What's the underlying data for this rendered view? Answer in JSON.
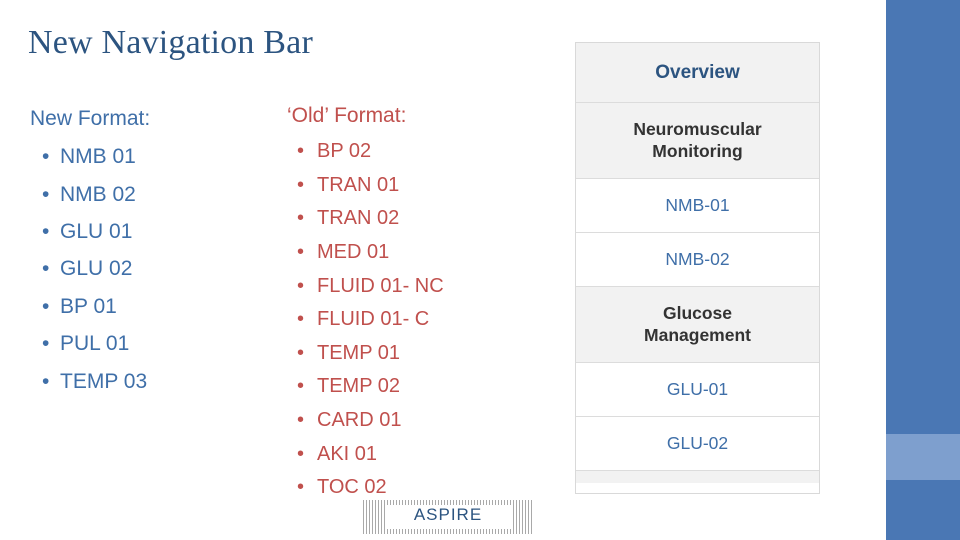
{
  "slide": {
    "title": "New Navigation Bar"
  },
  "columns": {
    "new": {
      "heading": "New Format:",
      "bullet_glyph": "•",
      "items": [
        "NMB 01",
        "NMB 02",
        "GLU 01",
        "GLU 02",
        "BP 01",
        "PUL 01",
        "TEMP 03"
      ]
    },
    "old": {
      "heading": "‘Old’ Format:",
      "bullet_glyph": "•",
      "items": [
        "BP 02",
        "TRAN 01",
        "TRAN 02",
        "MED 01",
        "FLUID 01- NC",
        "FLUID 01- C",
        "TEMP 01",
        "TEMP 02",
        "CARD 01",
        "AKI 01",
        "TOC 02"
      ]
    }
  },
  "nav_panel": {
    "items": [
      {
        "label": "Overview",
        "style": "header"
      },
      {
        "label": "Neuromuscular\nMonitoring",
        "style": "section"
      },
      {
        "label": "NMB-01",
        "style": "link"
      },
      {
        "label": "NMB-02",
        "style": "link"
      },
      {
        "label": "Glucose\nManagement",
        "style": "section"
      },
      {
        "label": "GLU-01",
        "style": "link"
      },
      {
        "label": "GLU-02",
        "style": "link"
      },
      {
        "label": "",
        "style": "partial"
      }
    ]
  },
  "footer": {
    "logo_text": "ASPIRE"
  },
  "colors": {
    "title_blue": "#2c5480",
    "new_blue": "#3f6fa8",
    "old_red": "#c0504d",
    "bar_blue": "#4a77b4",
    "bar_light_blue": "#7e9fce"
  }
}
